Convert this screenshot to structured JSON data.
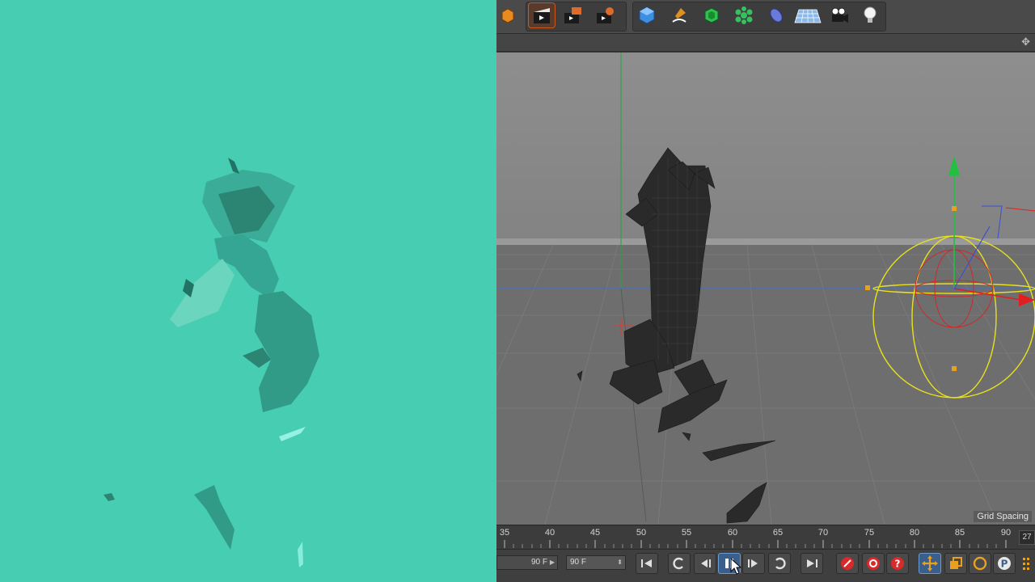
{
  "viewport": {
    "grid_spacing_label": "Grid Spacing"
  },
  "timeline": {
    "ticks": [
      "35",
      "40",
      "45",
      "50",
      "55",
      "60",
      "65",
      "70",
      "75",
      "80",
      "85",
      "90"
    ],
    "current_frame": "27"
  },
  "controls": {
    "preview_end_field": "90 F",
    "end_frame_field": "90 F"
  },
  "icons": {
    "toolbar": [
      "cube-small-icon",
      "render-view-icon",
      "render-picture-viewer-icon",
      "render-settings-icon",
      "cube-primitive-icon",
      "pen-spline-icon",
      "subdivision-generator-icon",
      "cloner-icon",
      "deformer-icon",
      "floor-grid-icon",
      "camera-icon",
      "light-bulb-icon"
    ],
    "playback": [
      "go-to-start-icon",
      "loop-icon",
      "step-back-icon",
      "pause-icon",
      "step-forward-icon",
      "repeat-icon",
      "go-to-end-icon",
      "record-icon",
      "autokey-icon",
      "keyframe-help-icon",
      "move-tool-icon",
      "scale-tool-icon",
      "rotate-tool-icon",
      "parameter-icon"
    ]
  },
  "colors": {
    "render_background": "#47cdb1",
    "viewport_background": "#858585",
    "active_button_accent": "#c85a20",
    "gizmo_yellow": "#e6e020",
    "axis_green": "#22c040",
    "axis_red": "#e02020"
  }
}
